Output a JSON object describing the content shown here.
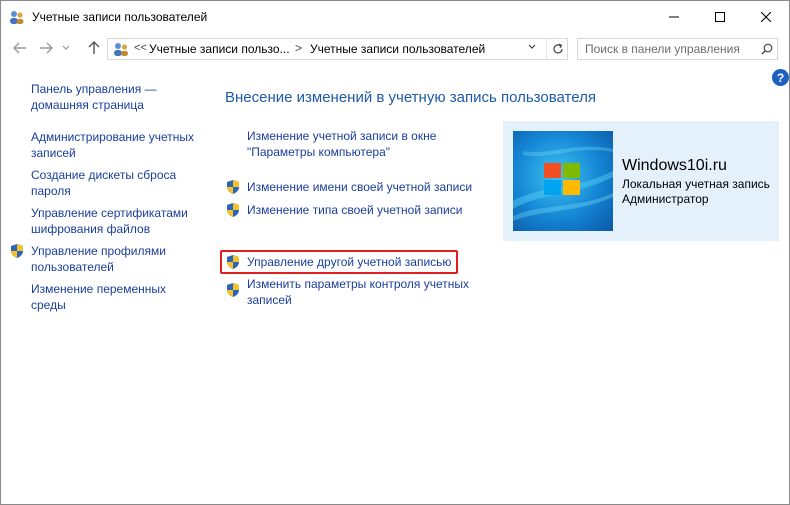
{
  "window": {
    "title": "Учетные записи пользователей"
  },
  "nav": {
    "crumb_prefix": "<<",
    "crumb1": "Учетные записи пользо...",
    "crumb_separator": ">",
    "crumb2": "Учетные записи пользователей",
    "search_placeholder": "Поиск в панели управления"
  },
  "help": {
    "label": "?"
  },
  "sidebar": {
    "items": [
      {
        "label_line1": "Панель управления —",
        "label_line2": "домашняя страница",
        "shield": false
      },
      {
        "label_line1": "Администрирование учетных",
        "label_line2": "записей",
        "shield": false
      },
      {
        "label_line1": "Создание дискеты сброса",
        "label_line2": "пароля",
        "shield": false
      },
      {
        "label_line1": "Управление сертификатами",
        "label_line2": "шифрования файлов",
        "shield": false
      },
      {
        "label_line1": "Управление профилями",
        "label_line2": "пользователей",
        "shield": true
      },
      {
        "label_line1": "Изменение переменных",
        "label_line2": "среды",
        "shield": false
      }
    ]
  },
  "main": {
    "title": "Внесение изменений в учетную запись пользователя",
    "links": [
      {
        "line1": "Изменение учетной записи в окне",
        "line2": "\"Параметры компьютера\"",
        "shield": false
      },
      {
        "line1": "Изменение имени своей учетной записи",
        "shield": true
      },
      {
        "line1": "Изменение типа своей учетной записи",
        "shield": true
      },
      {
        "line1": "Управление другой учетной записью",
        "shield": true,
        "highlighted": true
      },
      {
        "line1": "Изменить параметры контроля учетных",
        "line2": "записей",
        "shield": true
      }
    ]
  },
  "account": {
    "name": "Windows10i.ru",
    "type": "Локальная учетная запись",
    "role": "Администратор"
  },
  "colors": {
    "link": "#1a3e9c",
    "heading": "#1e5aa8",
    "highlight_border": "#e01e1e",
    "card_bg": "#e4f1fb"
  }
}
